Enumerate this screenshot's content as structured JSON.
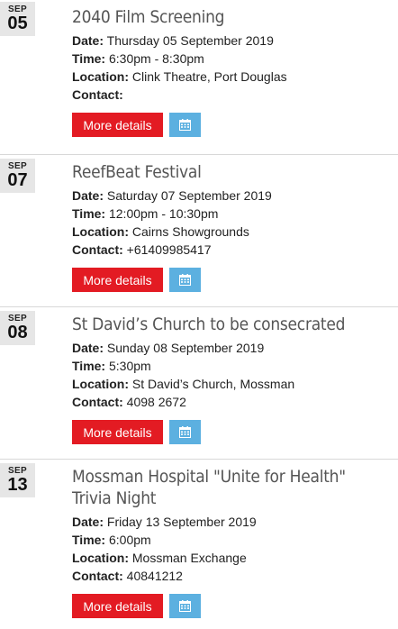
{
  "labels": {
    "date": "Date:",
    "time": "Time:",
    "location": "Location:",
    "contact": "Contact:",
    "more_details": "More details"
  },
  "events": [
    {
      "month": "SEP",
      "day": "05",
      "title": "2040 Film Screening",
      "date": "Thursday 05 September 2019",
      "time": "6:30pm - 8:30pm",
      "location": "Clink Theatre, Port Douglas",
      "contact": ""
    },
    {
      "month": "SEP",
      "day": "07",
      "title": "ReefBeat Festival",
      "date": "Saturday 07 September 2019",
      "time": "12:00pm - 10:30pm",
      "location": "Cairns Showgrounds",
      "contact": "+61409985417"
    },
    {
      "month": "SEP",
      "day": "08",
      "title": "St David’s Church to be consecrated",
      "date": "Sunday 08 September 2019",
      "time": "5:30pm",
      "location": "St David’s Church, Mossman",
      "contact": "4098 2672"
    },
    {
      "month": "SEP",
      "day": "13",
      "title": "Mossman Hospital \"Unite for Health\" Trivia Night",
      "date": "Friday 13 September 2019",
      "time": "6:00pm",
      "location": "Mossman Exchange",
      "contact": "40841212"
    }
  ],
  "colors": {
    "more_button": "#e31b23",
    "calendar_button": "#5cb0e0",
    "date_box": "#e6e6e6"
  },
  "icons": {
    "calendar_button": "calendar-icon"
  }
}
